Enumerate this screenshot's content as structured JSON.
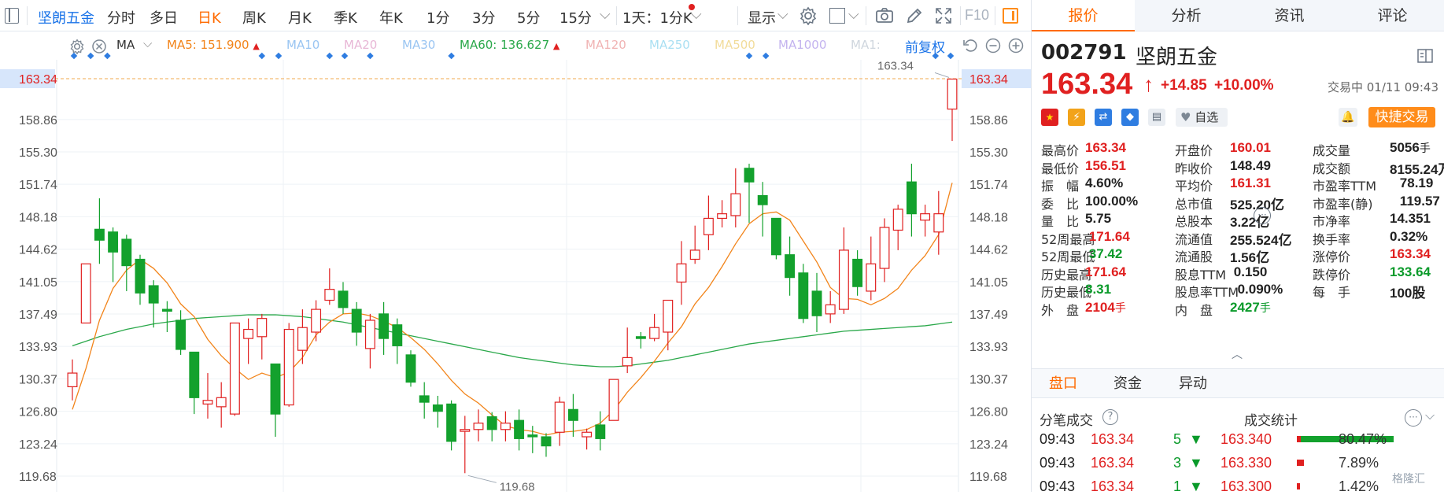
{
  "toolbar": {
    "stock_name": "坚朗五金",
    "periods": [
      "分时",
      "多日",
      "日K",
      "周K",
      "月K",
      "季K",
      "年K",
      "1分",
      "3分",
      "5分",
      "15分"
    ],
    "active_period": "日K",
    "multi_period": "1天：1分K",
    "display_label": "显示",
    "f10_label": "F10",
    "icons": [
      "sidebar-toggle-icon",
      "settings-icon",
      "square-icon",
      "camera-icon",
      "pen-icon",
      "fullscreen-icon",
      "panel-toggle-icon"
    ]
  },
  "ma_row": {
    "ma_label": "MA",
    "items": [
      {
        "label": "MA5: 151.900",
        "color": "#f2841a",
        "arrow": "up"
      },
      {
        "label": "MA10",
        "color": "#9ac5f2"
      },
      {
        "label": "MA20",
        "color": "#e8b7d6"
      },
      {
        "label": "MA30",
        "color": "#9ac5f2"
      },
      {
        "label": "MA60: 136.627",
        "color": "#2aa84a",
        "arrow": "up"
      },
      {
        "label": "MA120",
        "color": "#f0b3b3"
      },
      {
        "label": "MA250",
        "color": "#a9dff2"
      },
      {
        "label": "MA500",
        "color": "#f2dc9a"
      },
      {
        "label": "MA1000",
        "color": "#c3b3ef"
      },
      {
        "label": "MA1:",
        "color": "#cfd6de"
      }
    ],
    "adjust_label": "前复权"
  },
  "chart_data": {
    "type": "candlestick",
    "y_ticks": [
      "163.34",
      "158.86",
      "155.30",
      "151.74",
      "148.18",
      "144.62",
      "141.05",
      "137.49",
      "133.93",
      "130.37",
      "126.80",
      "123.24",
      "119.68"
    ],
    "ylim": [
      119.68,
      163.34
    ],
    "current_price_label": "163.34",
    "max_label": "163.34",
    "min_label": "119.68",
    "candles": [
      {
        "o": 129.5,
        "c": 131.0,
        "h": 132.5,
        "l": 128.0
      },
      {
        "o": 136.5,
        "c": 143.0,
        "h": 143.0,
        "l": 136.5
      },
      {
        "o": 146.8,
        "c": 145.6,
        "h": 150.2,
        "l": 143.0
      },
      {
        "o": 146.5,
        "c": 144.3,
        "h": 147.0,
        "l": 141.0
      },
      {
        "o": 145.7,
        "c": 142.8,
        "h": 146.2,
        "l": 140.0
      },
      {
        "o": 143.5,
        "c": 139.8,
        "h": 144.0,
        "l": 138.5
      },
      {
        "o": 140.6,
        "c": 138.7,
        "h": 141.2,
        "l": 136.0
      },
      {
        "o": 138.0,
        "c": 137.8,
        "h": 138.9,
        "l": 135.5
      },
      {
        "o": 136.8,
        "c": 133.6,
        "h": 137.9,
        "l": 133.0
      },
      {
        "o": 133.3,
        "c": 128.3,
        "h": 133.3,
        "l": 126.5
      },
      {
        "o": 127.6,
        "c": 128.0,
        "h": 131.0,
        "l": 126.0
      },
      {
        "o": 127.3,
        "c": 128.3,
        "h": 130.0,
        "l": 125.0
      },
      {
        "o": 126.5,
        "c": 136.5,
        "h": 136.5,
        "l": 126.3
      },
      {
        "o": 134.8,
        "c": 135.8,
        "h": 137.0,
        "l": 132.0
      },
      {
        "o": 135.0,
        "c": 137.0,
        "h": 137.5,
        "l": 132.5
      },
      {
        "o": 132.0,
        "c": 126.5,
        "h": 132.0,
        "l": 124.0
      },
      {
        "o": 127.5,
        "c": 135.8,
        "h": 136.5,
        "l": 127.3
      },
      {
        "o": 133.5,
        "c": 136.0,
        "h": 138.0,
        "l": 132.0
      },
      {
        "o": 135.5,
        "c": 138.0,
        "h": 139.0,
        "l": 134.5
      },
      {
        "o": 139.0,
        "c": 140.2,
        "h": 142.5,
        "l": 138.5
      },
      {
        "o": 140.0,
        "c": 138.2,
        "h": 141.0,
        "l": 137.5
      },
      {
        "o": 138.0,
        "c": 135.5,
        "h": 138.8,
        "l": 134.0
      },
      {
        "o": 133.7,
        "c": 136.8,
        "h": 137.5,
        "l": 131.5
      },
      {
        "o": 137.5,
        "c": 134.8,
        "h": 138.8,
        "l": 133.0
      },
      {
        "o": 136.3,
        "c": 134.0,
        "h": 137.0,
        "l": 132.0
      },
      {
        "o": 133.0,
        "c": 130.0,
        "h": 133.5,
        "l": 129.5
      },
      {
        "o": 128.5,
        "c": 127.8,
        "h": 130.0,
        "l": 126.0
      },
      {
        "o": 127.5,
        "c": 126.8,
        "h": 128.5,
        "l": 125.0
      },
      {
        "o": 127.6,
        "c": 123.5,
        "h": 128.0,
        "l": 122.5
      },
      {
        "o": 124.6,
        "c": 124.8,
        "h": 126.3,
        "l": 120.0
      },
      {
        "o": 124.8,
        "c": 125.5,
        "h": 127.0,
        "l": 123.5
      },
      {
        "o": 126.2,
        "c": 124.8,
        "h": 126.7,
        "l": 123.5
      },
      {
        "o": 124.8,
        "c": 125.5,
        "h": 126.8,
        "l": 123.5
      },
      {
        "o": 125.8,
        "c": 123.8,
        "h": 127.0,
        "l": 122.5
      },
      {
        "o": 124.2,
        "c": 124.0,
        "h": 125.2,
        "l": 122.2
      },
      {
        "o": 124.0,
        "c": 123.0,
        "h": 124.4,
        "l": 121.8
      },
      {
        "o": 124.5,
        "c": 127.8,
        "h": 128.4,
        "l": 123.0
      },
      {
        "o": 127.0,
        "c": 125.8,
        "h": 128.7,
        "l": 124.0
      },
      {
        "o": 124.0,
        "c": 124.5,
        "h": 124.9,
        "l": 122.6
      },
      {
        "o": 125.3,
        "c": 123.8,
        "h": 126.8,
        "l": 122.5
      },
      {
        "o": 125.8,
        "c": 130.3,
        "h": 130.3,
        "l": 125.8
      },
      {
        "o": 131.8,
        "c": 132.7,
        "h": 136.0,
        "l": 131.0
      },
      {
        "o": 135.0,
        "c": 134.8,
        "h": 135.5,
        "l": 133.7
      },
      {
        "o": 134.8,
        "c": 136.0,
        "h": 137.5,
        "l": 134.5
      },
      {
        "o": 135.5,
        "c": 139.0,
        "h": 139.0,
        "l": 133.5
      },
      {
        "o": 141.0,
        "c": 143.0,
        "h": 145.5,
        "l": 138.5
      },
      {
        "o": 143.5,
        "c": 144.5,
        "h": 147.2,
        "l": 143.0
      },
      {
        "o": 146.2,
        "c": 148.0,
        "h": 150.5,
        "l": 144.5
      },
      {
        "o": 148.0,
        "c": 148.5,
        "h": 150.0,
        "l": 147.0
      },
      {
        "o": 148.3,
        "c": 150.7,
        "h": 153.5,
        "l": 147.0
      },
      {
        "o": 153.5,
        "c": 152.0,
        "h": 154.0,
        "l": 147.5
      },
      {
        "o": 150.5,
        "c": 149.5,
        "h": 152.0,
        "l": 146.0
      },
      {
        "o": 148.0,
        "c": 144.0,
        "h": 148.0,
        "l": 143.5
      },
      {
        "o": 144.0,
        "c": 141.5,
        "h": 146.0,
        "l": 139.5
      },
      {
        "o": 142.0,
        "c": 137.0,
        "h": 143.0,
        "l": 136.5
      },
      {
        "o": 140.0,
        "c": 137.3,
        "h": 142.0,
        "l": 135.5
      },
      {
        "o": 137.5,
        "c": 138.5,
        "h": 140.0,
        "l": 136.5
      },
      {
        "o": 138.0,
        "c": 144.5,
        "h": 147.0,
        "l": 137.5
      },
      {
        "o": 143.5,
        "c": 140.5,
        "h": 144.5,
        "l": 139.5
      },
      {
        "o": 140.0,
        "c": 143.0,
        "h": 146.0,
        "l": 139.0
      },
      {
        "o": 142.5,
        "c": 147.0,
        "h": 148.0,
        "l": 141.0
      },
      {
        "o": 146.7,
        "c": 149.0,
        "h": 149.5,
        "l": 144.5
      },
      {
        "o": 152.0,
        "c": 148.5,
        "h": 154.0,
        "l": 146.0
      },
      {
        "o": 147.8,
        "c": 148.5,
        "h": 149.5,
        "l": 146.0
      },
      {
        "o": 146.5,
        "c": 148.5,
        "h": 151.0,
        "l": 144.0
      },
      {
        "o": 160.0,
        "c": 163.3,
        "h": 163.3,
        "l": 156.5
      }
    ],
    "ma5": [
      127.0,
      131.5,
      136.8,
      140.3,
      142.3,
      143.5,
      142.5,
      140.9,
      138.6,
      137.2,
      134.7,
      132.9,
      131.5,
      130.3,
      131.0,
      130.5,
      131.1,
      132.7,
      135.2,
      136.6,
      137.5,
      137.6,
      137.3,
      136.7,
      136.0,
      134.9,
      133.6,
      132.0,
      130.2,
      128.7,
      127.7,
      126.4,
      125.2,
      124.8,
      124.6,
      124.2,
      124.5,
      124.6,
      124.8,
      125.5,
      126.9,
      128.9,
      130.5,
      132.3,
      134.3,
      136.1,
      138.6,
      140.4,
      142.7,
      145.2,
      147.4,
      148.5,
      148.7,
      147.8,
      145.5,
      143.2,
      140.4,
      139.2,
      139.1,
      138.5,
      139.2,
      140.3,
      142.3,
      143.9,
      146.2,
      151.9
    ],
    "ma60": [
      134.0,
      134.5,
      135.0,
      135.4,
      135.8,
      136.1,
      136.4,
      136.6,
      136.8,
      137.0,
      137.1,
      137.2,
      137.3,
      137.4,
      137.4,
      137.4,
      137.3,
      137.2,
      137.0,
      136.8,
      136.6,
      136.3,
      136.0,
      135.7,
      135.4,
      135.1,
      134.8,
      134.5,
      134.2,
      133.9,
      133.6,
      133.3,
      133.0,
      132.7,
      132.5,
      132.3,
      132.1,
      131.9,
      131.8,
      131.7,
      131.7,
      131.8,
      132.0,
      132.2,
      132.4,
      132.7,
      133.0,
      133.3,
      133.6,
      133.9,
      134.2,
      134.4,
      134.6,
      134.8,
      135.0,
      135.2,
      135.4,
      135.6,
      135.7,
      135.8,
      135.9,
      136.0,
      136.1,
      136.2,
      136.4,
      136.6
    ]
  },
  "panel": {
    "tabs": [
      "报价",
      "分析",
      "资讯",
      "评论"
    ],
    "active_tab": "报价",
    "code": "002791",
    "name": "坚朗五金",
    "price": "163.34",
    "arrow": "↑",
    "change": "+14.85",
    "change_pct": "+10.00%",
    "status": "交易中 01/11 09:43",
    "watch_label": "自选",
    "quick_trade": "快捷交易",
    "quote_rows": [
      [
        {
          "l": "最高价",
          "v": "163.34",
          "c": "red"
        },
        {
          "l": "开盘价",
          "v": "160.01",
          "c": "red"
        },
        {
          "l": "成交量",
          "v": "5056",
          "u": "手",
          "c": "dark"
        }
      ],
      [
        {
          "l": "最低价",
          "v": "156.51",
          "c": "red"
        },
        {
          "l": "昨收价",
          "v": "148.49",
          "c": "dark"
        },
        {
          "l": "成交额",
          "v": "8155.24万",
          "c": "dark"
        }
      ],
      [
        {
          "l": "振　幅",
          "v": "4.60%",
          "c": "dark"
        },
        {
          "l": "平均价",
          "v": "161.31",
          "c": "red"
        },
        {
          "l": "市盈率TTM",
          "v": "78.19",
          "c": "dark"
        }
      ],
      [
        {
          "l": "委　比",
          "v": "100.00%",
          "c": "dark"
        },
        {
          "l": "总市值",
          "v": "525.20亿",
          "c": "dark"
        },
        {
          "l": "市盈率(静)",
          "v": "119.57",
          "c": "dark"
        }
      ],
      [
        {
          "l": "量　比",
          "v": "5.75",
          "c": "dark"
        },
        {
          "l": "总股本",
          "v": "3.22亿",
          "c": "dark"
        },
        {
          "l": "市净率",
          "v": "14.351",
          "c": "dark"
        }
      ],
      [
        {
          "l": "52周最高",
          "v": "171.64",
          "c": "red"
        },
        {
          "l": "流通值",
          "v": "255.524亿",
          "c": "dark"
        },
        {
          "l": "换手率",
          "v": "0.32%",
          "c": "dark"
        }
      ],
      [
        {
          "l": "52周最低",
          "v": "37.42",
          "c": "green"
        },
        {
          "l": "流通股",
          "v": "1.56亿",
          "c": "dark"
        },
        {
          "l": "涨停价",
          "v": "163.34",
          "c": "red"
        }
      ],
      [
        {
          "l": "历史最高",
          "v": "171.64",
          "c": "red"
        },
        {
          "l": "股息TTM",
          "v": "0.150",
          "c": "dark"
        },
        {
          "l": "跌停价",
          "v": "133.64",
          "c": "green"
        }
      ],
      [
        {
          "l": "历史最低",
          "v": "8.31",
          "c": "green"
        },
        {
          "l": "股息率TTM",
          "v": "0.090%",
          "c": "dark"
        },
        {
          "l": "每　手",
          "v": "100股",
          "c": "dark"
        }
      ],
      [
        {
          "l": "外　盘",
          "v": "2104",
          "u": "手",
          "c": "red"
        },
        {
          "l": "内　盘",
          "v": "2427",
          "u": "手",
          "c": "green"
        }
      ]
    ],
    "sub_tabs": [
      "盘口",
      "资金",
      "异动"
    ],
    "trades_title": "分笔成交",
    "stats_title": "成交统计",
    "trades": [
      {
        "time": "09:43",
        "price": "163.34",
        "vol": "5"
      },
      {
        "time": "09:43",
        "price": "163.34",
        "vol": "3"
      },
      {
        "time": "09:43",
        "price": "163.34",
        "vol": "1"
      }
    ],
    "stats": [
      {
        "price": "163.340",
        "pct": "80.47%",
        "ratio": 0.8
      },
      {
        "price": "163.330",
        "pct": "7.89%",
        "ratio": 0.08
      },
      {
        "price": "163.300",
        "pct": "1.42%",
        "ratio": 0.02
      }
    ],
    "watermark": "格隆汇"
  }
}
